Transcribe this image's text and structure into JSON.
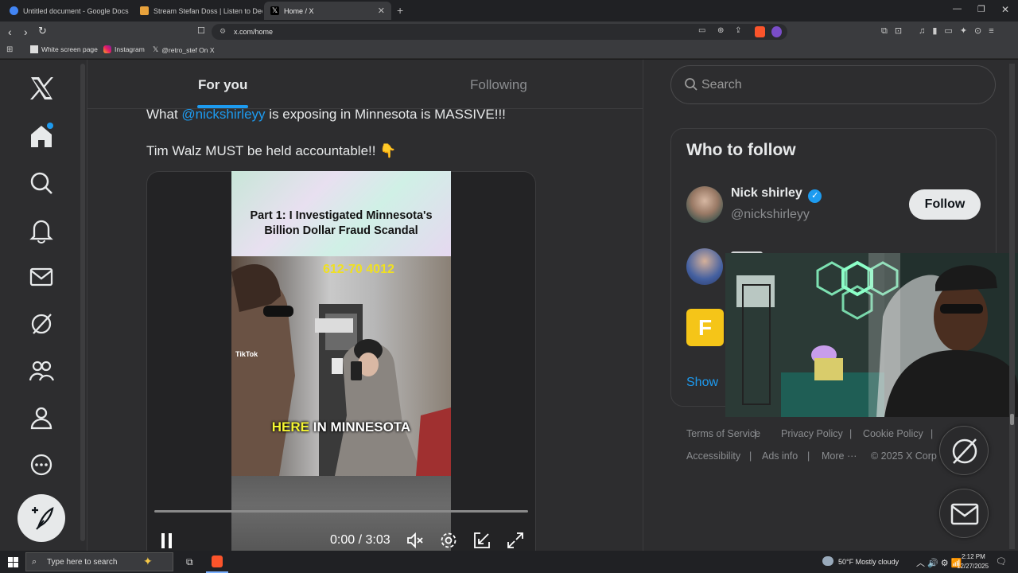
{
  "browser": {
    "tabs": [
      {
        "title": "Untitled document - Google Docs",
        "active": false
      },
      {
        "title": "Stream Stefan Doss | Listen to Decem",
        "active": false
      },
      {
        "title": "Home / X",
        "active": true
      }
    ],
    "url": "x.com/home",
    "bookmarks": [
      "White screen page",
      "Instagram",
      "@retro_stef On X"
    ]
  },
  "feed": {
    "tabs": [
      "For you",
      "Following"
    ],
    "post_line1_pre": "What ",
    "post_mention": "@nickshirleyy",
    "post_line1_post": " is exposing in Minnesota is MASSIVE!!!",
    "post_line2": "Tim Walz MUST be held accountable!! 👇",
    "video": {
      "caption": "Part 1: I Investigated Minnesota's Billion Dollar Fraud Scandal",
      "phone": "612-70  4012",
      "overlay_hl": "HERE",
      "overlay_rest": " IN MINNESOTA",
      "tiktok": "TikTok",
      "progress": 0.0,
      "time": "0:00 / 3:03"
    }
  },
  "sidebar": {
    "search_placeholder": "Search",
    "who_title": "Who to follow",
    "suggestions": [
      {
        "name": "Nick shirley",
        "handle": "@nickshirleyy",
        "button": "Follow"
      }
    ],
    "show_more": "Show",
    "footer": [
      "Terms of Service",
      "Privacy Policy",
      "Cookie Policy",
      "Accessibility",
      "Ads info",
      "More ···",
      "© 2025 X Corp"
    ]
  },
  "taskbar": {
    "search_placeholder": "Type here to search",
    "weather": "50°F  Mostly cloudy",
    "time": "2:12 PM",
    "date": "12/27/2025"
  },
  "colors": {
    "accent": "#1d9bf0",
    "bg": "#2d2d2f"
  }
}
